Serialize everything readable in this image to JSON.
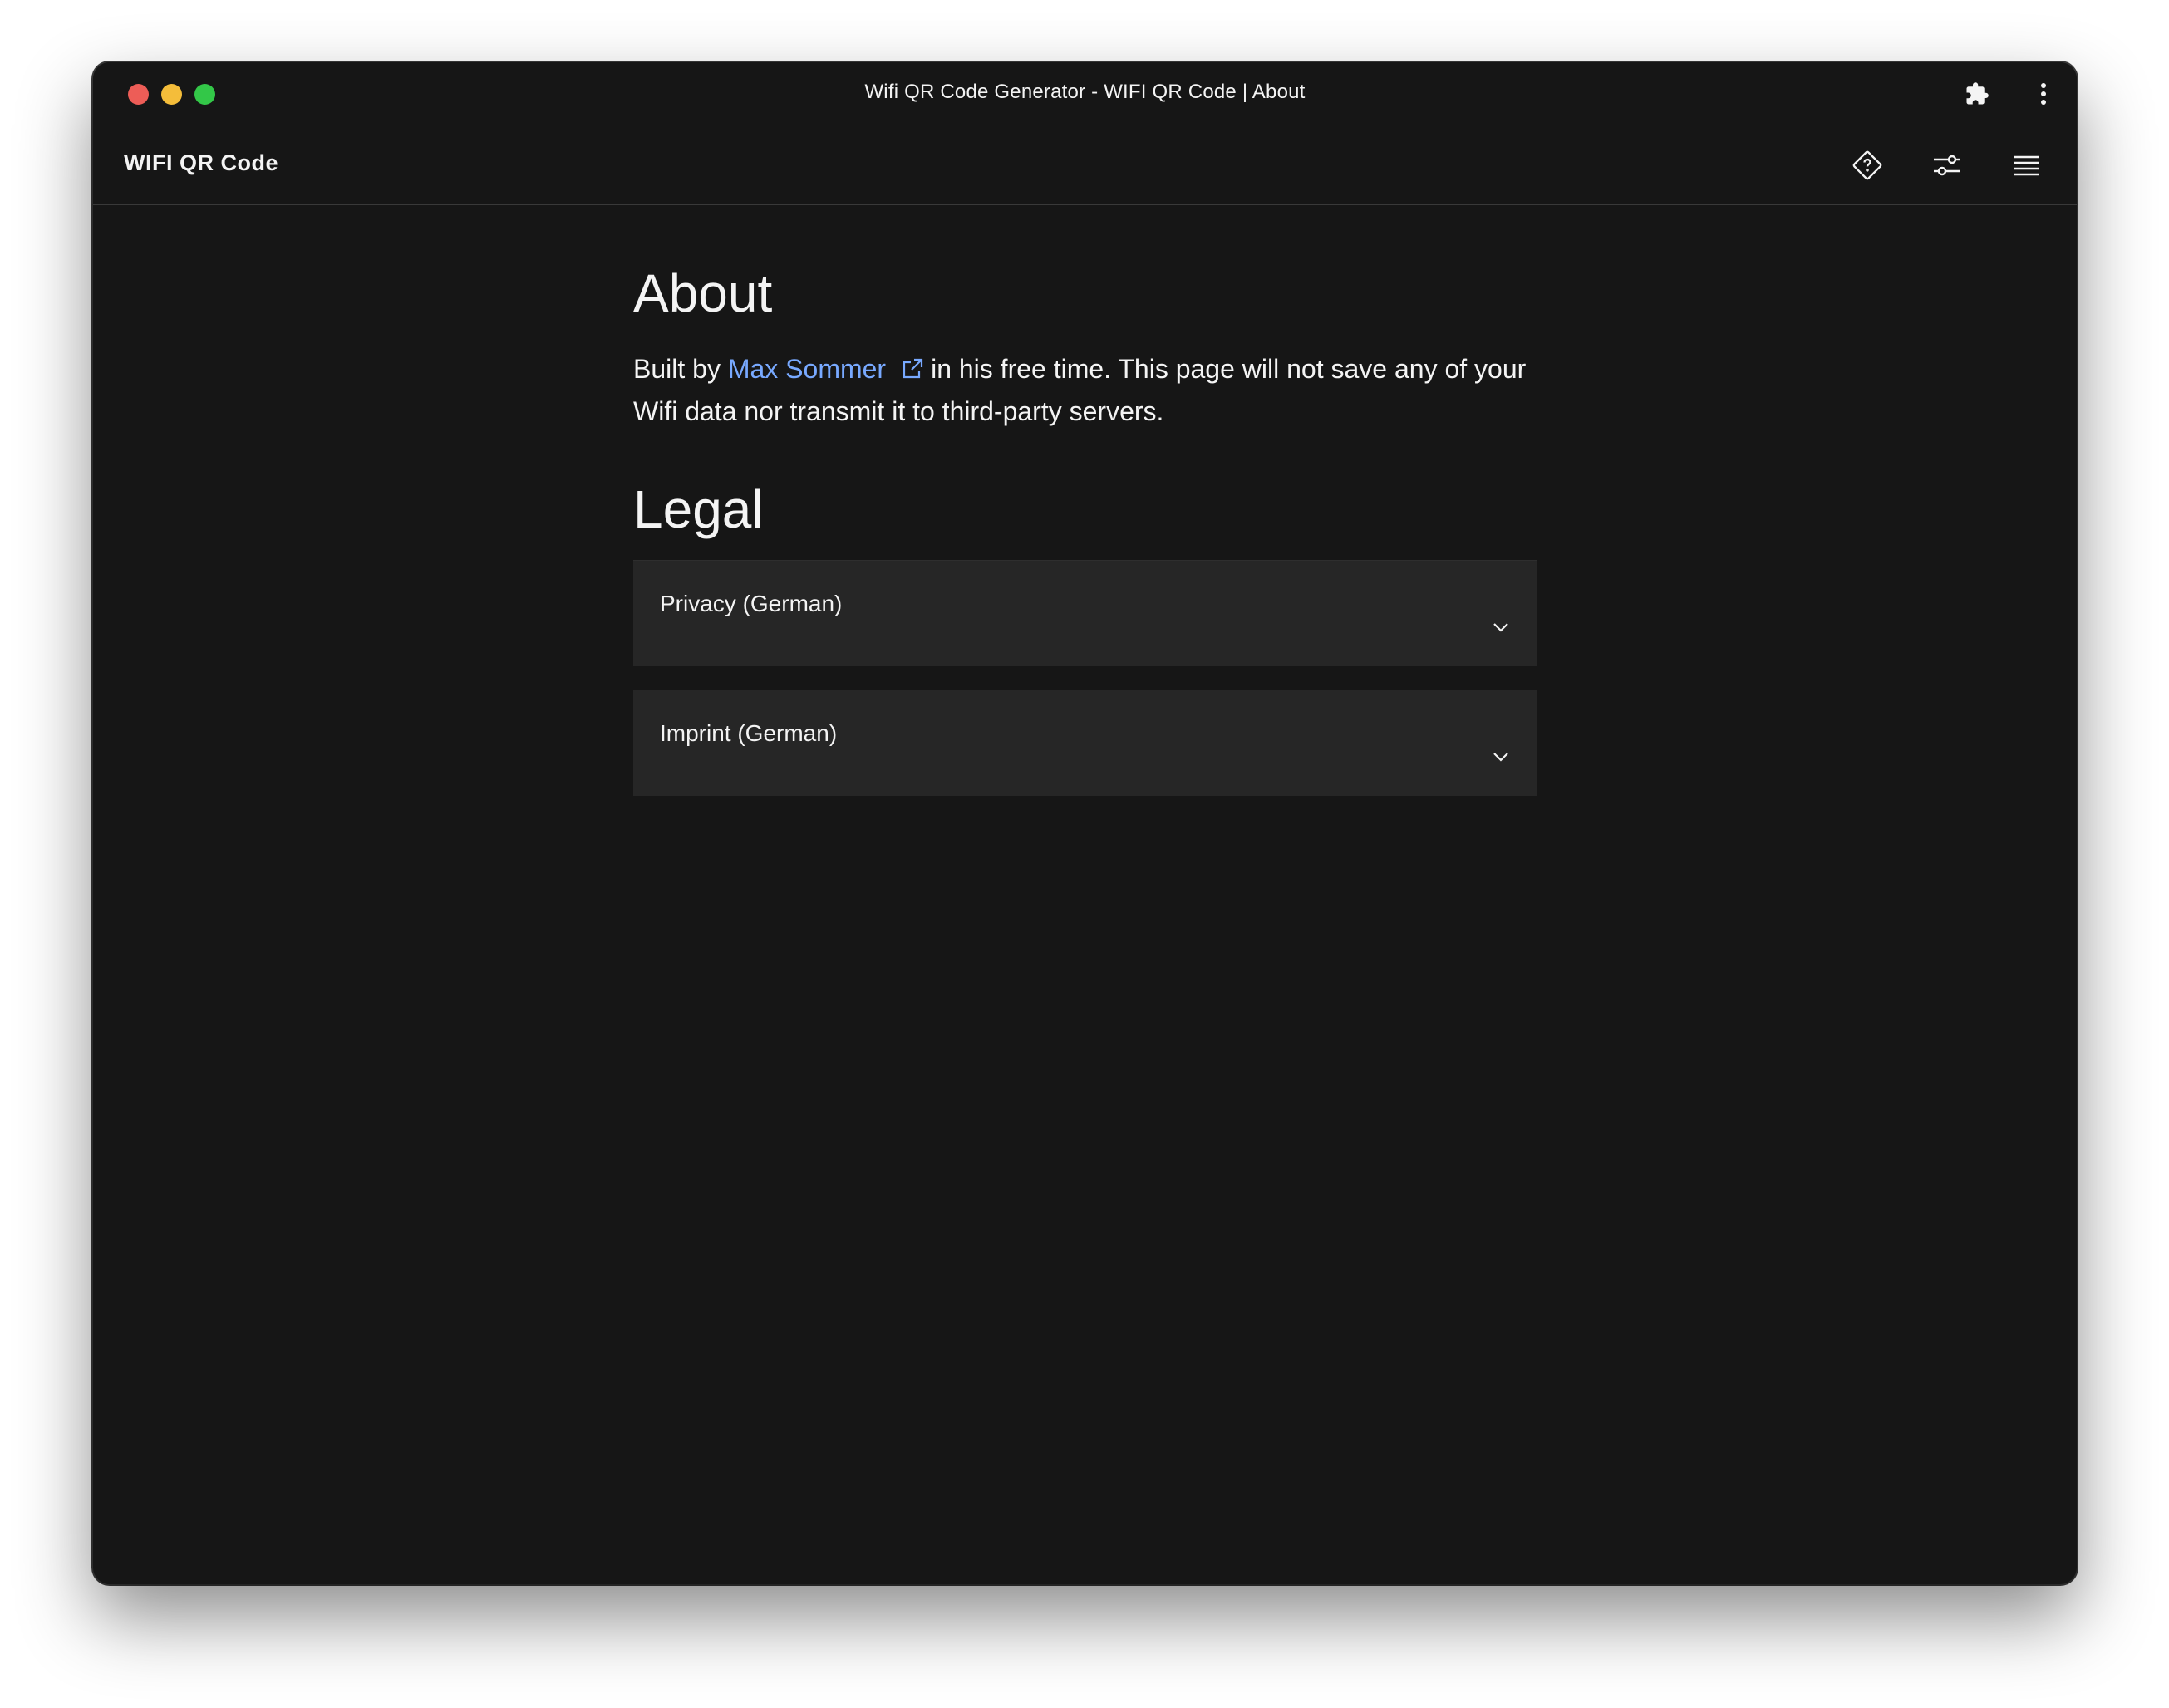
{
  "window": {
    "title": "Wifi QR Code Generator - WIFI QR Code | About"
  },
  "header": {
    "app_name": "WIFI QR Code",
    "icons": [
      "help-diamond-icon",
      "settings-sliders-icon",
      "menu-icon"
    ]
  },
  "about": {
    "heading": "About",
    "text_before": "Built by",
    "author_link": "Max Sommer",
    "text_after": "in his free time. This page will not save any of your Wifi data nor transmit it to third-party servers."
  },
  "legal": {
    "heading": "Legal",
    "items": [
      {
        "label": "Privacy (German)"
      },
      {
        "label": "Imprint (German)"
      }
    ]
  },
  "colors": {
    "background": "#161616",
    "panel": "#262626",
    "text": "#f4f4f4",
    "link": "#78a9ff"
  }
}
